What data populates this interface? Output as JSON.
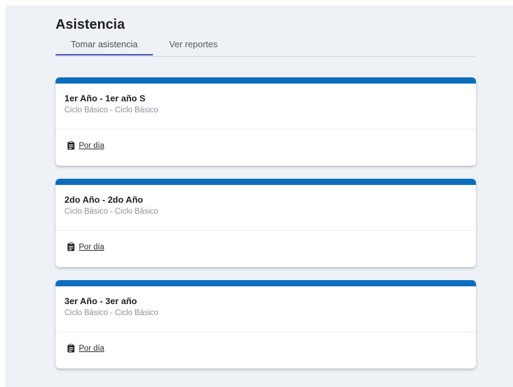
{
  "page": {
    "title": "Asistencia"
  },
  "tabs": [
    {
      "label": "Tomar asistencia",
      "active": true
    },
    {
      "label": "Ver reportes",
      "active": false
    }
  ],
  "colors": {
    "accent": "#0a6ebd",
    "tab_indicator": "#3f51b5",
    "background": "#eef1f5"
  },
  "cards": [
    {
      "title": "1er Año - 1er año S",
      "subtitle": "Ciclo Básico - Ciclo Básico",
      "action": {
        "icon": "clipboard-icon",
        "label": "Por día"
      }
    },
    {
      "title": "2do Año - 2do Año",
      "subtitle": "Ciclo Básico - Ciclo Básico",
      "action": {
        "icon": "clipboard-icon",
        "label": "Por día"
      }
    },
    {
      "title": "3er Año - 3er año",
      "subtitle": "Ciclo Básico - Ciclo Básico",
      "action": {
        "icon": "clipboard-icon",
        "label": "Por día"
      }
    }
  ]
}
